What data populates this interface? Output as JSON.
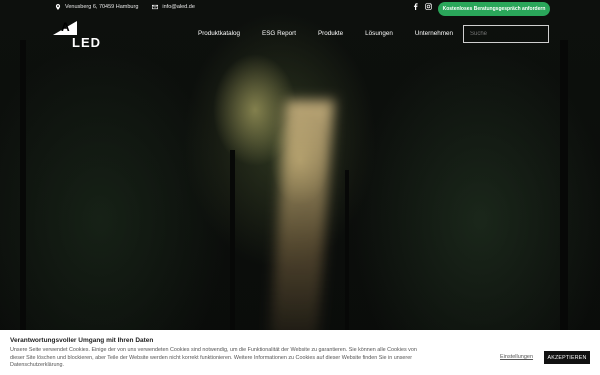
{
  "topbar": {
    "address": "Venusberg 6, 70459 Hamburg",
    "email": "info@aled.de",
    "cta_label": "Kostenloses Beratungsgespräch anfordern"
  },
  "logo": {
    "letter": "A",
    "text": "LED"
  },
  "nav": {
    "items": [
      "Produktkatalog",
      "ESG Report",
      "Produkte",
      "Lösungen",
      "Unternehmen"
    ]
  },
  "search": {
    "placeholder": "Suche"
  },
  "cookie": {
    "title": "Verantwortungsvoller Umgang mit Ihren Daten",
    "text": "Unsere Seite verwendet Cookies. Einige der von uns verwendeten Cookies sind notwendig, um die Funktionalität der Website zu garantieren. Sie können alle Cookies von dieser Site löschen und blockieren, aber Teile der Website werden nicht korrekt funktionieren. Weitere Informationen zu Cookies auf dieser Website finden Sie in unserer Datenschutzerklärung.",
    "settings_label": "Einstellungen",
    "accept_label": "AKZEPTIEREN"
  },
  "colors": {
    "accent": "#2aa65a",
    "cookie_bg": "#ffffff",
    "accept_bg": "#111111"
  },
  "icons": [
    "location-pin-icon",
    "mail-icon",
    "facebook-icon",
    "instagram-icon"
  ]
}
